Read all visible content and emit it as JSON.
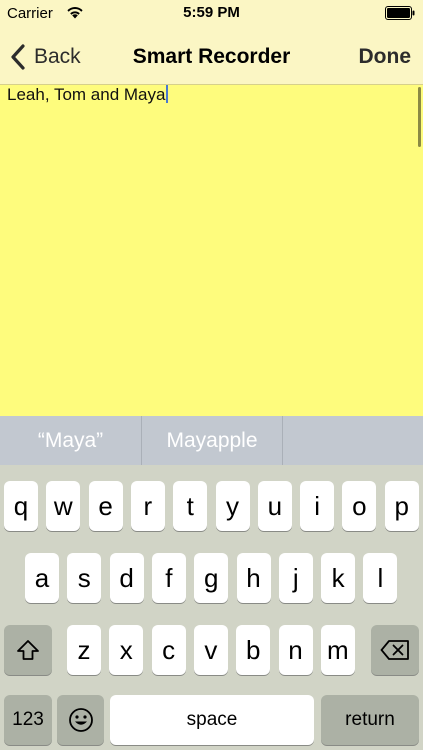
{
  "status": {
    "carrier": "Carrier",
    "time": "5:59 PM"
  },
  "nav": {
    "back_label": "Back",
    "title": "Smart Recorder",
    "done_label": "Done"
  },
  "editor": {
    "text": "Leah, Tom and Maya"
  },
  "suggestions": [
    "“Maya”",
    "Mayapple",
    ""
  ],
  "keyboard": {
    "row1": [
      "q",
      "w",
      "e",
      "r",
      "t",
      "y",
      "u",
      "i",
      "o",
      "p"
    ],
    "row2": [
      "a",
      "s",
      "d",
      "f",
      "g",
      "h",
      "j",
      "k",
      "l"
    ],
    "row3": [
      "z",
      "x",
      "c",
      "v",
      "b",
      "n",
      "m"
    ],
    "numbers_label": "123",
    "space_label": "space",
    "return_label": "return"
  },
  "icons": {
    "shift": "shift-icon",
    "delete": "delete-icon",
    "emoji": "emoji-icon",
    "back": "chevron-left-icon",
    "wifi": "wifi-icon",
    "battery": "battery-icon"
  },
  "colors": {
    "nav_background": "#fbf6c4",
    "editor_background": "#fefc7d",
    "suggestion_bar": "#c2c8d0",
    "keyboard_background": "#d1d4c6",
    "special_key": "#acb1a5",
    "caret": "#4a78d0"
  }
}
